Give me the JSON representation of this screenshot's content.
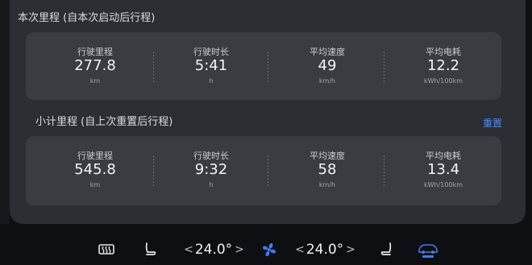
{
  "trip_current": {
    "title": "本次里程 (自本次启动后行程)",
    "stats": [
      {
        "label": "行驶里程",
        "value": "277.8",
        "unit": "km"
      },
      {
        "label": "行驶时长",
        "value": "5:41",
        "unit": "h"
      },
      {
        "label": "平均速度",
        "value": "49",
        "unit": "km/h"
      },
      {
        "label": "平均电耗",
        "value": "12.2",
        "unit": "kWh/100km"
      }
    ]
  },
  "trip_subtotal": {
    "title": "小计里程 (自上次重置后行程)",
    "reset_label": "重置",
    "stats": [
      {
        "label": "行驶里程",
        "value": "545.8",
        "unit": "km"
      },
      {
        "label": "行驶时长",
        "value": "9:32",
        "unit": "h"
      },
      {
        "label": "平均速度",
        "value": "58",
        "unit": "km/h"
      },
      {
        "label": "平均电耗",
        "value": "13.4",
        "unit": "kWh/100km"
      }
    ]
  },
  "climate_bar": {
    "left_temp": "24.0°",
    "right_temp": "24.0°",
    "chevron_left": "<",
    "chevron_right": ">",
    "icons": [
      "rear-defrost-icon",
      "seat-heat-left-icon",
      "fan-icon",
      "seat-heat-right-icon",
      "auto-climate-car-icon"
    ],
    "accent_color": "#3d7bf0"
  },
  "colors": {
    "background": "#0d0f12",
    "panel": "#2c2e33",
    "card": "#3a3c42",
    "link": "#4b8cf5"
  }
}
